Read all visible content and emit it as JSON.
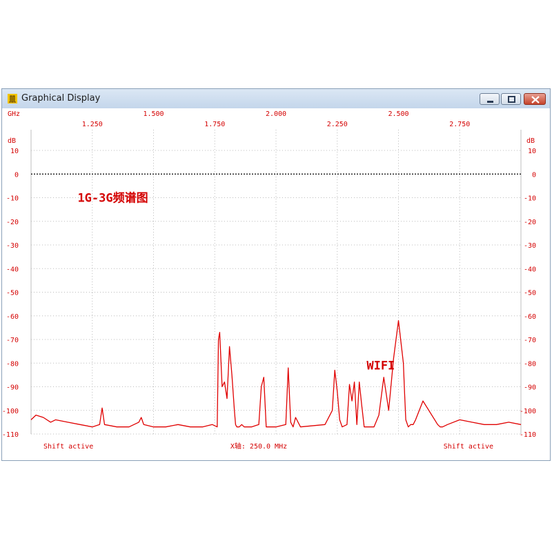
{
  "window": {
    "title": "Graphical Display",
    "icon": "app-spectrum-icon",
    "controls": [
      "minimize-icon",
      "maximize-icon",
      "close-icon"
    ]
  },
  "status": {
    "left": "Shift active",
    "center": "X轴: 250.0 MHz",
    "right": "Shift active"
  },
  "annotations": [
    {
      "text": "1G-3G频谱图",
      "x": 1.19,
      "y": -10
    },
    {
      "text": "WIFI",
      "x": 2.37,
      "y": -81
    }
  ],
  "colors": {
    "trace": "#e00000",
    "axis_text": "#d40000",
    "grid": "#bcbcbc",
    "reference": "#000000"
  },
  "chart_data": {
    "type": "line",
    "title": "1G-3G频谱图",
    "x_unit": "GHz",
    "y_unit": "dB",
    "xlim": [
      1.0,
      3.0
    ],
    "ylim": [
      -110,
      10
    ],
    "x_ticks_top": [
      1.5,
      2.0,
      2.5
    ],
    "x_ticks_bottom": [
      1.25,
      1.75,
      2.25,
      2.75
    ],
    "x_tick_labels_top": [
      "1.500",
      "2.000",
      "2.500"
    ],
    "x_tick_labels_bottom": [
      "1.250",
      "1.750",
      "2.250",
      "2.750"
    ],
    "y_ticks": [
      10,
      0,
      -10,
      -20,
      -30,
      -40,
      -50,
      -60,
      -70,
      -80,
      -90,
      -100,
      -110
    ],
    "y_tick_labels": [
      "10",
      "0",
      "-10",
      "-20",
      "-30",
      "-40",
      "-50",
      "-60",
      "-70",
      "-80",
      "-90",
      "-100",
      "-110"
    ],
    "reference_level": 0,
    "grid": true,
    "series": [
      {
        "color": "#e00000",
        "x": [
          1.0,
          1.02,
          1.05,
          1.08,
          1.1,
          1.15,
          1.2,
          1.25,
          1.28,
          1.29,
          1.3,
          1.35,
          1.4,
          1.44,
          1.45,
          1.46,
          1.5,
          1.55,
          1.6,
          1.65,
          1.7,
          1.74,
          1.76,
          1.765,
          1.77,
          1.78,
          1.79,
          1.8,
          1.81,
          1.82,
          1.83,
          1.835,
          1.84,
          1.85,
          1.86,
          1.87,
          1.9,
          1.93,
          1.94,
          1.95,
          1.96,
          2.0,
          2.04,
          2.05,
          2.06,
          2.07,
          2.08,
          2.1,
          2.2,
          2.23,
          2.24,
          2.25,
          2.26,
          2.27,
          2.29,
          2.3,
          2.31,
          2.32,
          2.33,
          2.34,
          2.35,
          2.36,
          2.38,
          2.4,
          2.42,
          2.44,
          2.46,
          2.48,
          2.5,
          2.52,
          2.525,
          2.53,
          2.54,
          2.55,
          2.56,
          2.57,
          2.6,
          2.66,
          2.67,
          2.68,
          2.7,
          2.75,
          2.8,
          2.85,
          2.9,
          2.95,
          3.0
        ],
        "y": [
          -104,
          -102,
          -103,
          -105,
          -104,
          -105,
          -106,
          -107,
          -106,
          -99,
          -106,
          -107,
          -107,
          -105,
          -103,
          -106,
          -107,
          -107,
          -106,
          -107,
          -107,
          -106,
          -107,
          -70,
          -67,
          -90,
          -88,
          -95,
          -73,
          -85,
          -100,
          -106,
          -107,
          -107,
          -106,
          -107,
          -107,
          -106,
          -90,
          -86,
          -107,
          -107,
          -106,
          -82,
          -105,
          -107,
          -103,
          -107,
          -106,
          -100,
          -83,
          -92,
          -104,
          -107,
          -106,
          -89,
          -96,
          -88,
          -106,
          -88,
          -98,
          -107,
          -107,
          -107,
          -102,
          -86,
          -100,
          -78,
          -62,
          -80,
          -93,
          -104,
          -107,
          -106,
          -106,
          -104,
          -96,
          -106,
          -107,
          -107,
          -106,
          -104,
          -105,
          -106,
          -106,
          -105,
          -106
        ]
      }
    ]
  }
}
